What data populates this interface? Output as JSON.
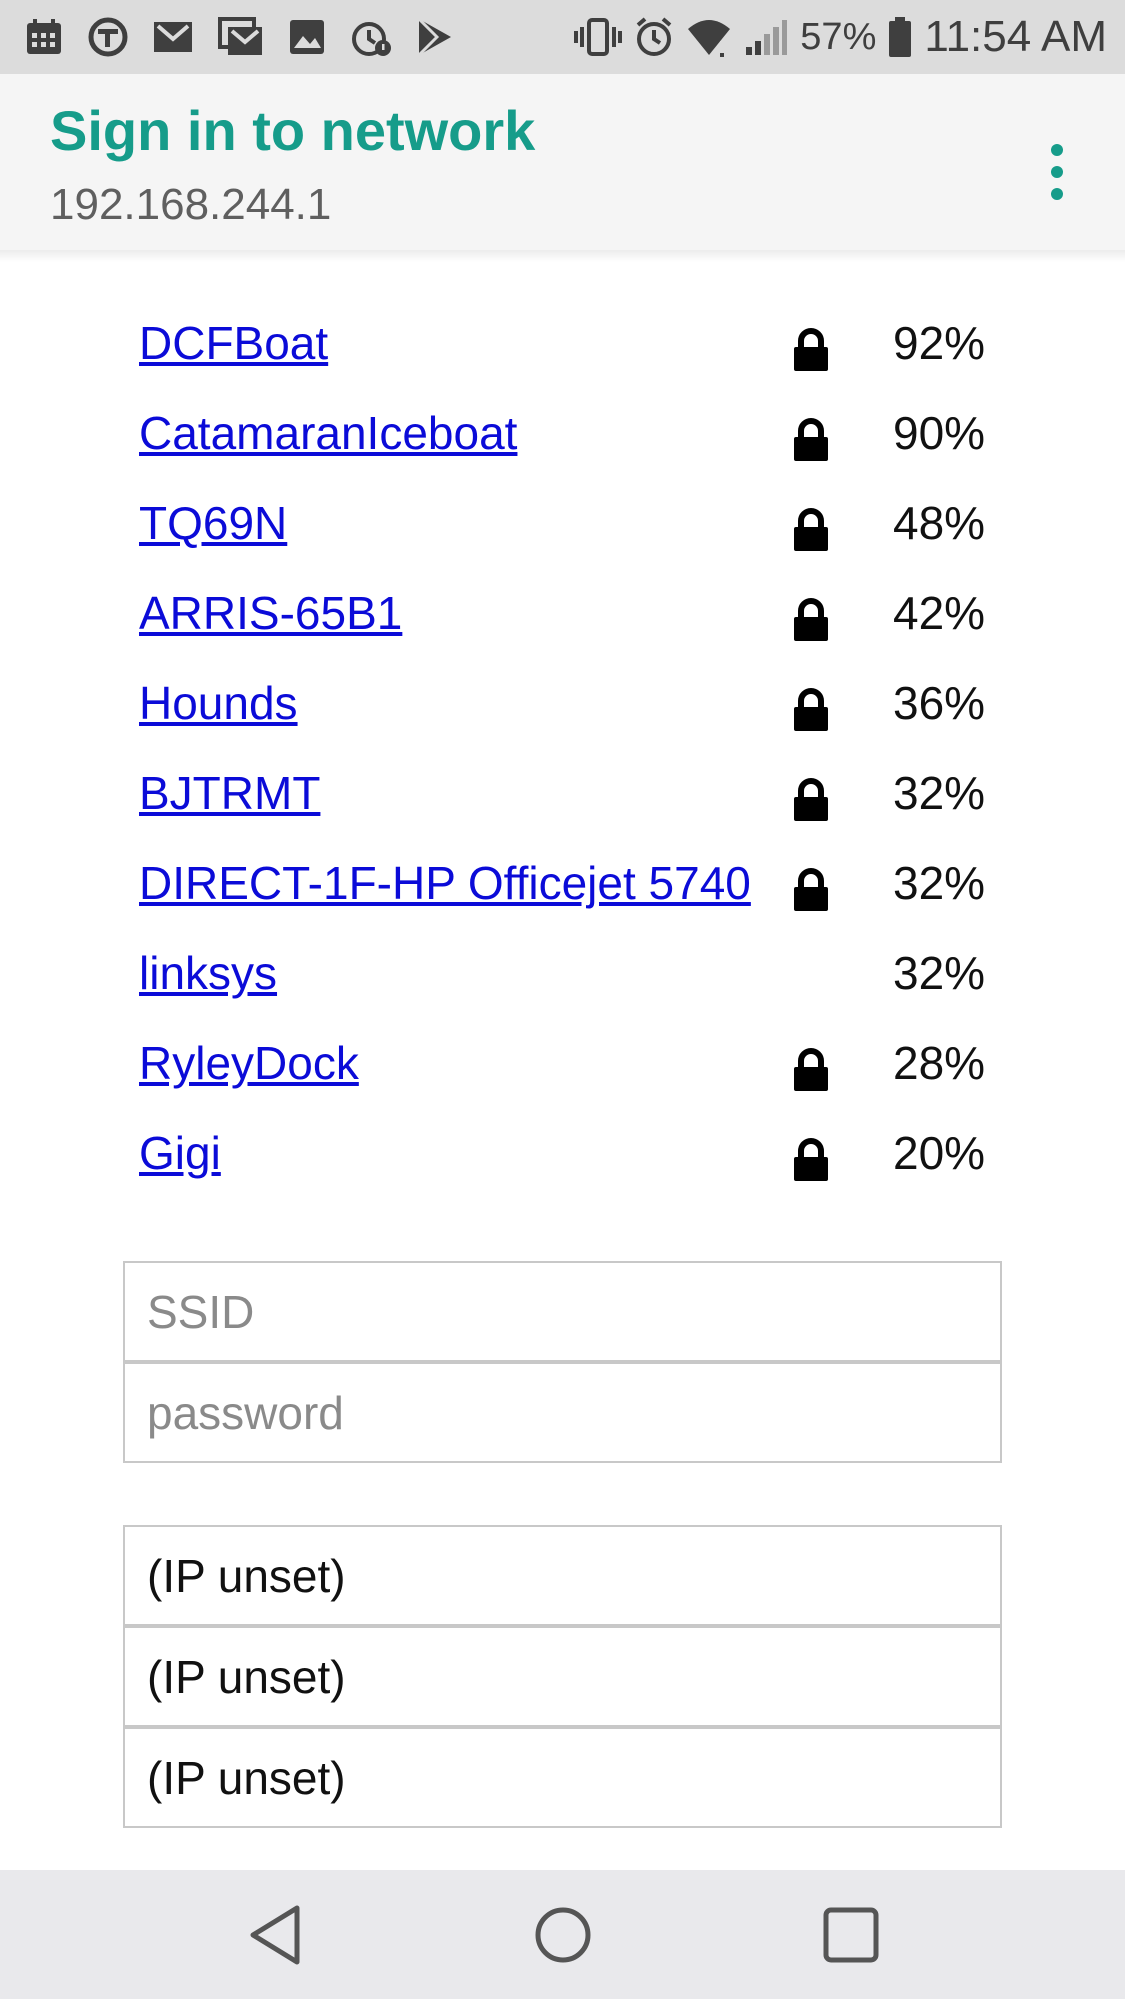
{
  "status_bar": {
    "battery_percent": "57%",
    "time": "11:54 AM"
  },
  "header": {
    "title": "Sign in to network",
    "subtitle": "192.168.244.1"
  },
  "networks": [
    {
      "ssid": "DCFBoat",
      "secured": true,
      "signal": "92%"
    },
    {
      "ssid": "CatamaranIceboat",
      "secured": true,
      "signal": "90%"
    },
    {
      "ssid": "TQ69N",
      "secured": true,
      "signal": "48%"
    },
    {
      "ssid": "ARRIS-65B1",
      "secured": true,
      "signal": "42%"
    },
    {
      "ssid": "Hounds",
      "secured": true,
      "signal": "36%"
    },
    {
      "ssid": "BJTRMT",
      "secured": true,
      "signal": "32%"
    },
    {
      "ssid": "DIRECT-1F-HP Officejet 5740",
      "secured": true,
      "signal": "32%"
    },
    {
      "ssid": "linksys",
      "secured": false,
      "signal": "32%"
    },
    {
      "ssid": "RyleyDock",
      "secured": true,
      "signal": "28%"
    },
    {
      "ssid": "Gigi",
      "secured": true,
      "signal": "20%"
    }
  ],
  "form": {
    "ssid_placeholder": "SSID",
    "password_placeholder": "password",
    "ip_fields": [
      "(IP unset)",
      "(IP unset)",
      "(IP unset)"
    ]
  },
  "colors": {
    "accent": "#169c8a",
    "link": "#0b0bd8"
  },
  "icons": {
    "secured": "lock-icon",
    "menu": "overflow-menu-icon",
    "nav": [
      "back-icon",
      "home-icon",
      "recents-icon"
    ]
  }
}
